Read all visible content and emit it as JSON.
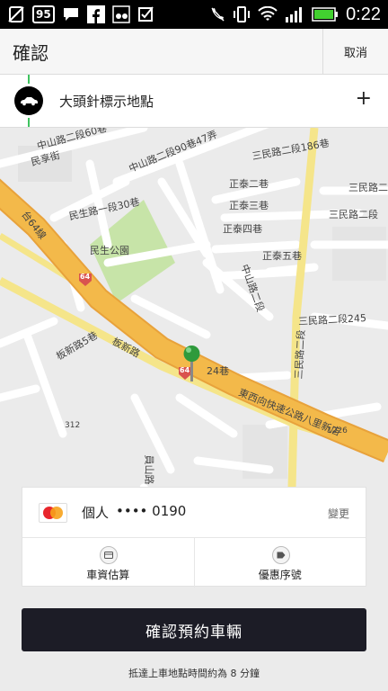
{
  "status_bar": {
    "badge_text": "95",
    "time": "0:22"
  },
  "header": {
    "title": "確認",
    "cancel_label": "取消"
  },
  "location": {
    "label": "大頭針標示地點",
    "add_symbol": "+"
  },
  "map": {
    "labels": [
      "民享街",
      "中山路二段60巷",
      "中山路二段90巷47弄",
      "三民路二段186巷",
      "台64線",
      "正泰二巷",
      "三民路二段",
      "正泰三巷",
      "三民路二段",
      "民生路一段30巷",
      "正泰四巷",
      "民生公園",
      "正泰五巷",
      "三民路二段245",
      "中山路二段",
      "板新路",
      "板新路5巷",
      "東西向快速公路八里新店",
      "三民路二段",
      "24巷",
      "1226",
      "312",
      "員山路"
    ],
    "route_shields": [
      "64",
      "64"
    ]
  },
  "payment": {
    "card_brand": "MasterCard",
    "name": "個人",
    "masked_number": "•••• 0190",
    "change_label": "變更",
    "fare_label": "車資估算",
    "promo_label": "優惠序號"
  },
  "confirm_button": {
    "label": "確認預約車輛"
  },
  "eta_text": "抵達上車地點時間約為 8 分鐘",
  "colors": {
    "accent_green": "#3fc35f",
    "button_dark": "#1c1c26",
    "road_orange": "#f3b94a",
    "road_yellow": "#f5e58a",
    "park_green": "#c7e4a8"
  }
}
